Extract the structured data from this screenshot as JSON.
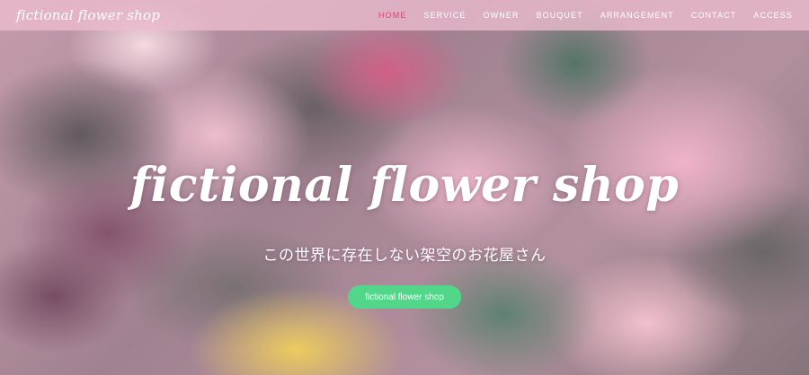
{
  "header": {
    "brand": "fictional flower shop",
    "nav": [
      {
        "label": "HOME",
        "active": true
      },
      {
        "label": "SERVICE",
        "active": false
      },
      {
        "label": "OWNER",
        "active": false
      },
      {
        "label": "BOUQUET",
        "active": false
      },
      {
        "label": "ARRANGEMENT",
        "active": false
      },
      {
        "label": "CONTACT",
        "active": false
      },
      {
        "label": "ACCESS",
        "active": false
      }
    ]
  },
  "hero": {
    "title": "fictional flower shop",
    "subtitle": "この世界に存在しない架空のお花屋さん",
    "cta_label": "fictional flower shop"
  },
  "colors": {
    "nav_active": "#d9436f",
    "nav_bar": "#ecbcce",
    "cta": "#52d68a"
  }
}
